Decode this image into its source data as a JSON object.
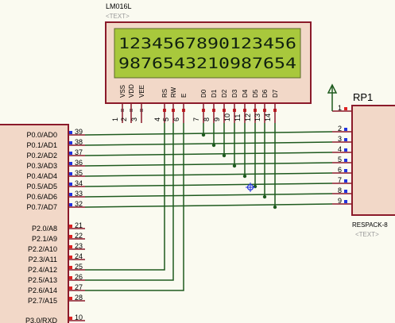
{
  "lcd": {
    "part": "LM016L",
    "text_label": "<TEXT>",
    "line1": "1234567890123456",
    "line2": "9876543210987654",
    "pins": [
      {
        "name": "VSS",
        "num": "1"
      },
      {
        "name": "VDD",
        "num": "2"
      },
      {
        "name": "VEE",
        "num": "3"
      },
      {
        "name": "RS",
        "num": "4"
      },
      {
        "name": "RW",
        "num": "5"
      },
      {
        "name": "E",
        "num": "6"
      },
      {
        "name": "D0",
        "num": "7"
      },
      {
        "name": "D1",
        "num": "8"
      },
      {
        "name": "D2",
        "num": "9"
      },
      {
        "name": "D3",
        "num": "10"
      },
      {
        "name": "D4",
        "num": "11"
      },
      {
        "name": "D5",
        "num": "12"
      },
      {
        "name": "D6",
        "num": "13"
      },
      {
        "name": "D7",
        "num": "14"
      }
    ]
  },
  "mcu": {
    "port0": [
      {
        "label": "P0.0/AD0",
        "num": "39"
      },
      {
        "label": "P0.1/AD1",
        "num": "38"
      },
      {
        "label": "P0.2/AD2",
        "num": "37"
      },
      {
        "label": "P0.3/AD3",
        "num": "36"
      },
      {
        "label": "P0.4/AD4",
        "num": "35"
      },
      {
        "label": "P0.5/AD5",
        "num": "34"
      },
      {
        "label": "P0.6/AD6",
        "num": "33"
      },
      {
        "label": "P0.7/AD7",
        "num": "32"
      }
    ],
    "port2": [
      {
        "label": "P2.0/A8",
        "num": "21"
      },
      {
        "label": "P2.1/A9",
        "num": "22"
      },
      {
        "label": "P2.2/A10",
        "num": "23"
      },
      {
        "label": "P2.3/A11",
        "num": "24"
      },
      {
        "label": "P2.4/A12",
        "num": "25"
      },
      {
        "label": "P2.5/A13",
        "num": "26"
      },
      {
        "label": "P2.6/A14",
        "num": "27"
      },
      {
        "label": "P2.7/A15",
        "num": "28"
      }
    ],
    "port3": [
      {
        "label": "P3.0/RXD",
        "num": "10"
      }
    ]
  },
  "rp": {
    "name": "RP1",
    "part": "RESPACK-8",
    "text_label": "<TEXT>",
    "pins": [
      "1",
      "2",
      "3",
      "4",
      "5",
      "6",
      "7",
      "8",
      "9"
    ]
  },
  "colors": {
    "background": "#fafaf0",
    "component_border": "#8b1a2a",
    "component_fill": "#f2d8c8",
    "lcd_screen": "#a8c83c",
    "lcd_text": "#102010",
    "wire": "#1e5a1e",
    "pin_red": "#dd2222",
    "pin_blue": "#2233dd",
    "pin_gray": "#8a8a8a",
    "label_gray": "#999999"
  }
}
